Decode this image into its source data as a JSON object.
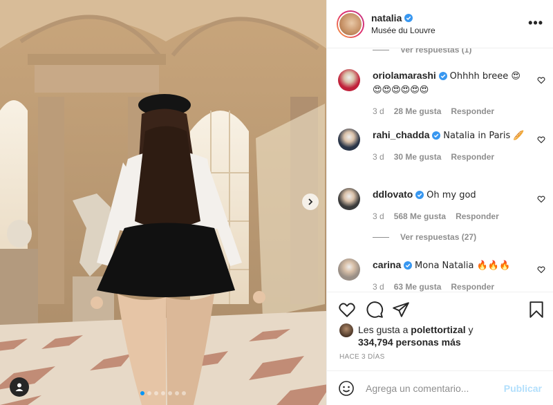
{
  "post": {
    "username": "natalia",
    "location": "Musée du Louvre",
    "more_icon": "more-options-icon",
    "carousel": {
      "slides": 7,
      "active": 0
    }
  },
  "comments": [
    {
      "type": "replies",
      "label": "Ver respuestas (1)"
    },
    {
      "type": "comment",
      "user": "oriolamarashi",
      "verified": true,
      "text": "Ohhhh breee 😍",
      "text2": "😍😍😍😍😍😍",
      "time": "3 d",
      "likes": "28 Me gusta",
      "reply": "Responder",
      "avatar_color": "#c0213a"
    },
    {
      "type": "comment",
      "user": "rahi_chadda",
      "verified": true,
      "text": "Natalia in Paris 🥖",
      "time": "3 d",
      "likes": "30 Me gusta",
      "reply": "Responder",
      "avatar_color": "#2a3548"
    },
    {
      "type": "comment",
      "user": "ddlovato",
      "verified": true,
      "text": "Oh my god",
      "time": "3 d",
      "likes": "568 Me gusta",
      "reply": "Responder",
      "avatar_color": "#3b3b3b"
    },
    {
      "type": "replies",
      "label": "Ver respuestas (27)"
    },
    {
      "type": "comment",
      "user": "carina",
      "verified": true,
      "text": "Mona Natalia 🔥🔥🔥",
      "time": "3 d",
      "likes": "63 Me gusta",
      "reply": "Responder",
      "avatar_color": "#9a8f86"
    }
  ],
  "likes": {
    "prefix": "Les gusta a",
    "user": "polettortizal",
    "conj": "y",
    "others": "334,794 personas más"
  },
  "time_ago": "HACE 3 DÍAS",
  "add_comment": {
    "placeholder": "Agrega un comentario...",
    "publish": "Publicar"
  },
  "colors": {
    "accent": "#0095f6",
    "publish_disabled": "#b2dffc",
    "verified": "#3897f0"
  }
}
